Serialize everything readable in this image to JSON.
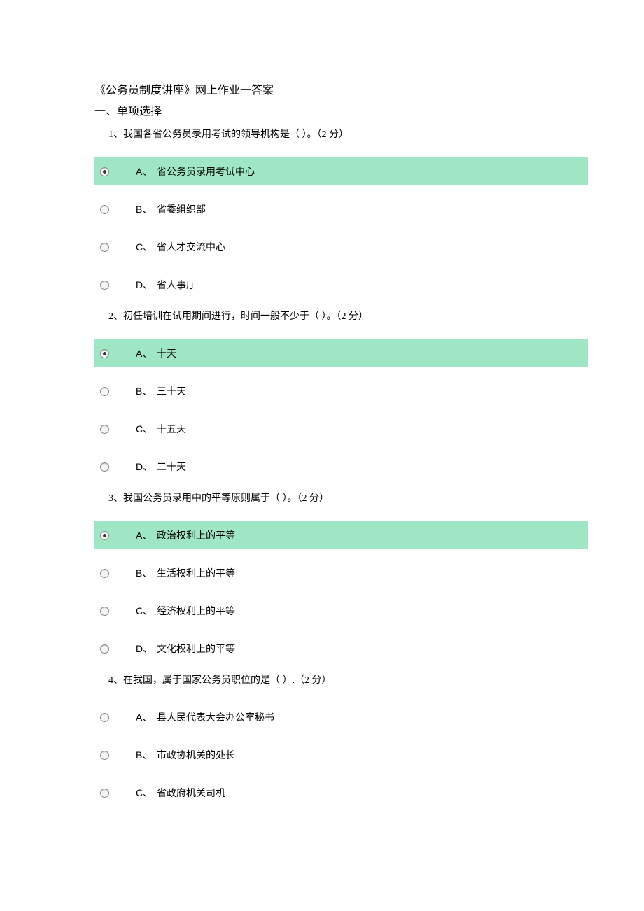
{
  "title": "《公务员制度讲座》网上作业一答案",
  "section_heading": "一、单项选择",
  "questions": [
    {
      "text": "1、我国各省公务员录用考试的领导机构是（ ）。（2 分）",
      "options": [
        {
          "letter": "A、",
          "text": "省公务员录用考试中心",
          "selected": true
        },
        {
          "letter": "B、",
          "text": "省委组织部",
          "selected": false
        },
        {
          "letter": "C、",
          "text": "省人才交流中心",
          "selected": false
        },
        {
          "letter": "D、",
          "text": "省人事厅",
          "selected": false
        }
      ]
    },
    {
      "text": "2、初任培训在试用期间进行，时间一般不少于（ ）。（2 分）",
      "options": [
        {
          "letter": "A、",
          "text": "十天",
          "selected": true
        },
        {
          "letter": "B、",
          "text": "三十天",
          "selected": false
        },
        {
          "letter": "C、",
          "text": "十五天",
          "selected": false
        },
        {
          "letter": "D、",
          "text": "二十天",
          "selected": false
        }
      ]
    },
    {
      "text": "3、我国公务员录用中的平等原则属于（ ）。（2 分）",
      "options": [
        {
          "letter": "A、",
          "text": "政治权利上的平等",
          "selected": true
        },
        {
          "letter": "B、",
          "text": "生活权利上的平等",
          "selected": false
        },
        {
          "letter": "C、",
          "text": "经济权利上的平等",
          "selected": false
        },
        {
          "letter": "D、",
          "text": "文化权利上的平等",
          "selected": false
        }
      ]
    },
    {
      "text": "4、在我国，属于国家公务员职位的是（ ）.（2 分）",
      "options": [
        {
          "letter": "A、",
          "text": "县人民代表大会办公室秘书",
          "selected": false
        },
        {
          "letter": "B、",
          "text": "市政协机关的处长",
          "selected": false
        },
        {
          "letter": "C、",
          "text": "省政府机关司机",
          "selected": false
        }
      ]
    }
  ]
}
